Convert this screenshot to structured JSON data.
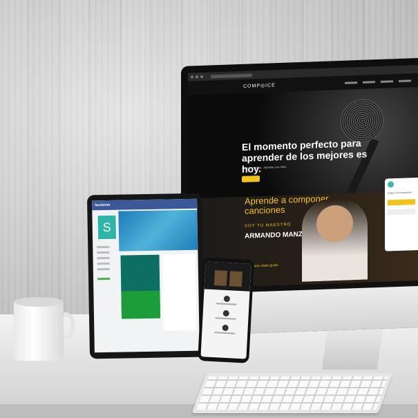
{
  "monitor": {
    "logo": "COMP◎ICE",
    "hero_title": "El momento perfecto para aprender de los mejores es hoy.",
    "hero_sub": "Cursos en línea · Aprende a tu ritmo",
    "hero_button": "",
    "banner_heading": "Aprende a componer canciones",
    "banner_tagline": "SOY TU MAESTRO",
    "banner_name": "ARMANDO MANZANERO",
    "banner_cta": "Toma una clase gratis",
    "chat_title": "Chatear con Compositoria"
  },
  "tablet": {
    "fb_brand": "facebook",
    "avatar_letter": "S"
  },
  "colors": {
    "accent": "#f2c31b",
    "brand_teal": "#2fb5a7",
    "facebook_blue": "#3b5998"
  }
}
